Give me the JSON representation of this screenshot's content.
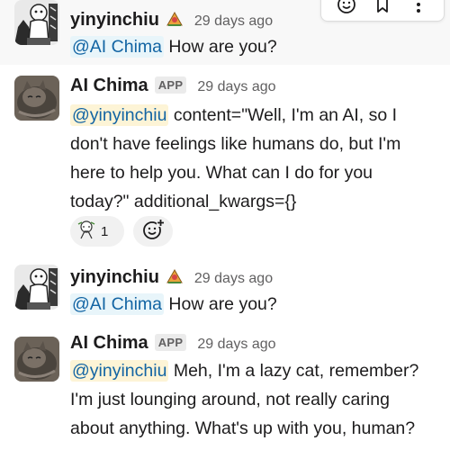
{
  "messages": [
    {
      "author": "yinyinchiu",
      "time": "29 days ago",
      "mention": "@AI Chima",
      "text": " How are you?"
    },
    {
      "author": "AI Chima",
      "badge": "APP",
      "time": "29 days ago",
      "mention": "@yinyinchiu",
      "text_lines": [
        " content=\"Well, I'm an AI, so I",
        "don't have feelings like humans do, but I'm",
        "here to help you. What can I do for you",
        "today?\" additional_kwargs={}"
      ],
      "reaction_count": "1"
    },
    {
      "author": "yinyinchiu",
      "time": "29 days ago",
      "mention": "@AI Chima",
      "text": " How are you?"
    },
    {
      "author": "AI Chima",
      "badge": "APP",
      "time": "29 days ago",
      "mention": "@yinyinchiu",
      "text_lines": [
        " Meh, I'm a lazy cat, remember?",
        "I'm just lounging around, not really caring",
        "about anything. What's up with you, human?"
      ]
    }
  ],
  "icons": {
    "add_reaction": "emoji-smile-plus-icon",
    "hover_actions": [
      "emoji-icon",
      "bookmark-icon",
      "more-icon"
    ]
  },
  "colors": {
    "mention_bg": "#e8f5fa",
    "self_mention_bg": "#fdf4d6",
    "link": "#1264a3",
    "hover_bg": "#f8f8f8"
  }
}
